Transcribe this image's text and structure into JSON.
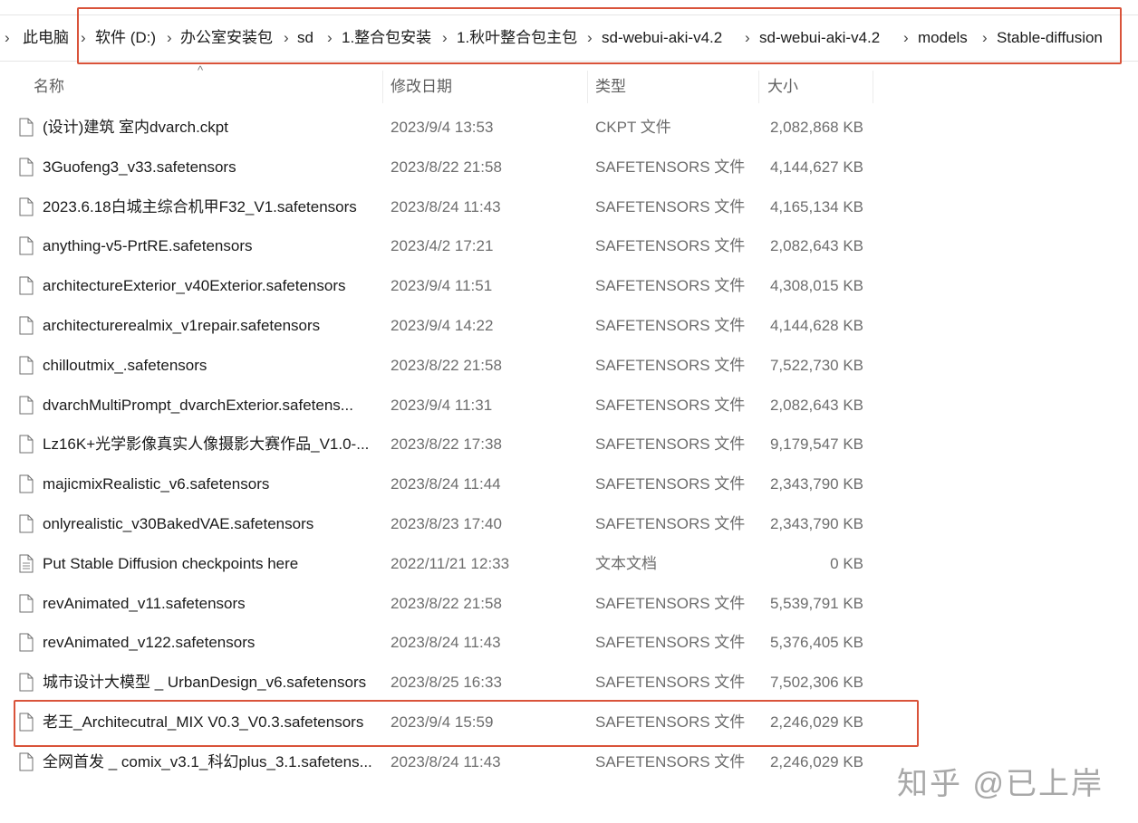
{
  "breadcrumb": {
    "items": [
      "此电脑",
      "软件 (D:)",
      "办公室安装包",
      "sd",
      "1.整合包安装",
      "1.秋叶整合包主包",
      "sd-webui-aki-v4.2",
      "sd-webui-aki-v4.2",
      "models",
      "Stable-diffusion"
    ],
    "separator": "›",
    "leading_separator": "›"
  },
  "columns": {
    "name": "名称",
    "date": "修改日期",
    "type": "类型",
    "size": "大小",
    "sort_indicator": "^"
  },
  "files": [
    {
      "name": "(设计)建筑 室内dvarch.ckpt",
      "date": "2023/9/4 13:53",
      "type": "CKPT 文件",
      "size": "2,082,868 KB",
      "icon": "file-icon"
    },
    {
      "name": "3Guofeng3_v33.safetensors",
      "date": "2023/8/22 21:58",
      "type": "SAFETENSORS 文件",
      "size": "4,144,627 KB",
      "icon": "file-icon"
    },
    {
      "name": "2023.6.18白城主综合机甲F32_V1.safetensors",
      "date": "2023/8/24 11:43",
      "type": "SAFETENSORS 文件",
      "size": "4,165,134 KB",
      "icon": "file-icon"
    },
    {
      "name": "anything-v5-PrtRE.safetensors",
      "date": "2023/4/2 17:21",
      "type": "SAFETENSORS 文件",
      "size": "2,082,643 KB",
      "icon": "file-icon"
    },
    {
      "name": "architectureExterior_v40Exterior.safetensors",
      "date": "2023/9/4 11:51",
      "type": "SAFETENSORS 文件",
      "size": "4,308,015 KB",
      "icon": "file-icon"
    },
    {
      "name": "architecturerealmix_v1repair.safetensors",
      "date": "2023/9/4 14:22",
      "type": "SAFETENSORS 文件",
      "size": "4,144,628 KB",
      "icon": "file-icon"
    },
    {
      "name": "chilloutmix_.safetensors",
      "date": "2023/8/22 21:58",
      "type": "SAFETENSORS 文件",
      "size": "7,522,730 KB",
      "icon": "file-icon"
    },
    {
      "name": "dvarchMultiPrompt_dvarchExterior.safetens...",
      "date": "2023/9/4 11:31",
      "type": "SAFETENSORS 文件",
      "size": "2,082,643 KB",
      "icon": "file-icon"
    },
    {
      "name": "Lz16K+光学影像真实人像摄影大赛作品_V1.0-...",
      "date": "2023/8/22 17:38",
      "type": "SAFETENSORS 文件",
      "size": "9,179,547 KB",
      "icon": "file-icon"
    },
    {
      "name": "majicmixRealistic_v6.safetensors",
      "date": "2023/8/24 11:44",
      "type": "SAFETENSORS 文件",
      "size": "2,343,790 KB",
      "icon": "file-icon"
    },
    {
      "name": "onlyrealistic_v30BakedVAE.safetensors",
      "date": "2023/8/23 17:40",
      "type": "SAFETENSORS 文件",
      "size": "2,343,790 KB",
      "icon": "file-icon"
    },
    {
      "name": "Put Stable Diffusion checkpoints here",
      "date": "2022/11/21 12:33",
      "type": "文本文档",
      "size": "0 KB",
      "icon": "text-file-icon"
    },
    {
      "name": "revAnimated_v11.safetensors",
      "date": "2023/8/22 21:58",
      "type": "SAFETENSORS 文件",
      "size": "5,539,791 KB",
      "icon": "file-icon"
    },
    {
      "name": "revAnimated_v122.safetensors",
      "date": "2023/8/24 11:43",
      "type": "SAFETENSORS 文件",
      "size": "5,376,405 KB",
      "icon": "file-icon"
    },
    {
      "name": "城市设计大模型 _ UrbanDesign_v6.safetensors",
      "date": "2023/8/25 16:33",
      "type": "SAFETENSORS 文件",
      "size": "7,502,306 KB",
      "icon": "file-icon"
    },
    {
      "name": "老王_Architecutral_MIX V0.3_V0.3.safetensors",
      "date": "2023/9/4 15:59",
      "type": "SAFETENSORS 文件",
      "size": "2,246,029 KB",
      "icon": "file-icon"
    },
    {
      "name": "全网首发 _ comix_v3.1_科幻plus_3.1.safetens...",
      "date": "2023/8/24 11:43",
      "type": "SAFETENSORS 文件",
      "size": "2,246,029 KB",
      "icon": "file-icon"
    }
  ],
  "annotations": {
    "highlight_color": "#d9533a"
  },
  "watermark": "知乎 @已上岸"
}
